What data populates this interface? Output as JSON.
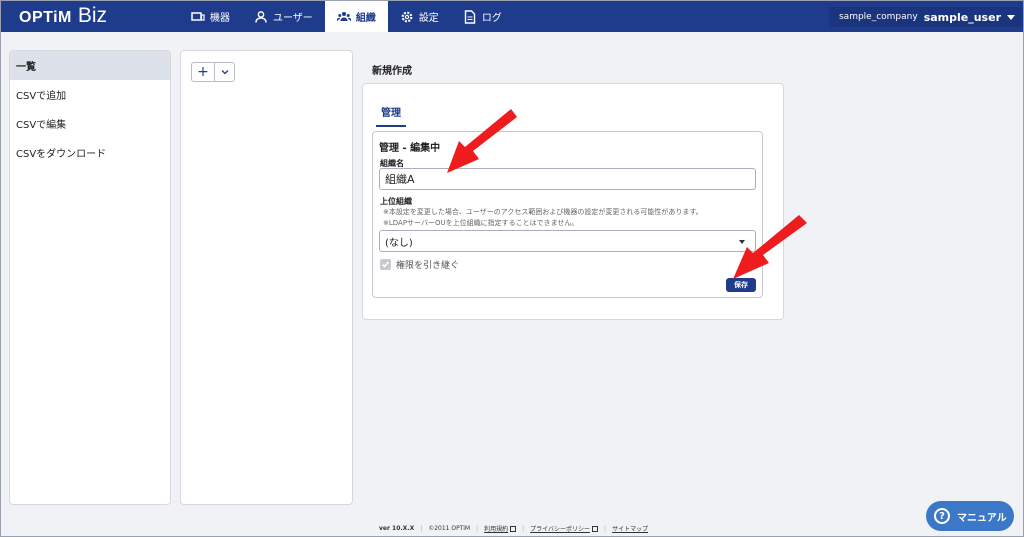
{
  "header": {
    "logo_text": "OPTiM",
    "logo_sub": "Biz",
    "nav": [
      {
        "label": "機器",
        "icon": "device-icon"
      },
      {
        "label": "ユーザー",
        "icon": "user-icon"
      },
      {
        "label": "組織",
        "icon": "org-icon"
      },
      {
        "label": "設定",
        "icon": "gear-icon"
      },
      {
        "label": "ログ",
        "icon": "log-icon"
      }
    ],
    "active_nav": "組織",
    "company": "sample_company",
    "username": "sample_user"
  },
  "sidebar": {
    "items": [
      {
        "label": "一覧"
      },
      {
        "label": "CSVで追加"
      },
      {
        "label": "CSVで編集"
      },
      {
        "label": "CSVをダウンロード"
      }
    ]
  },
  "tree": {
    "add_label": "+",
    "menu_label": "⌄"
  },
  "main": {
    "page_title": "新規作成",
    "tab_label": "管理",
    "form": {
      "title": "管理 - 編集中",
      "name_label": "組織名",
      "name_value": "組織A",
      "parent_label": "上位組織",
      "note1": "※本設定を変更した場合、ユーザーのアクセス範囲および機器の設定が変更される可能性があります。",
      "note2": "※LDAPサーバーOUを上位組織に指定することはできません。",
      "parent_value": "(なし)",
      "inherit_label": "権限を引き継ぐ",
      "save_label": "保存"
    }
  },
  "footer": {
    "version": "ver 10.X.X",
    "copyright": "©2011 OPTiM",
    "terms": "利用規約",
    "privacy": "プライバシーポリシー",
    "sitemap": "サイトマップ"
  },
  "manual_label": "マニュアル",
  "colors": {
    "primary": "#1f3b8c",
    "arrow": "#ee1c1c",
    "manual": "#3c78c8"
  }
}
